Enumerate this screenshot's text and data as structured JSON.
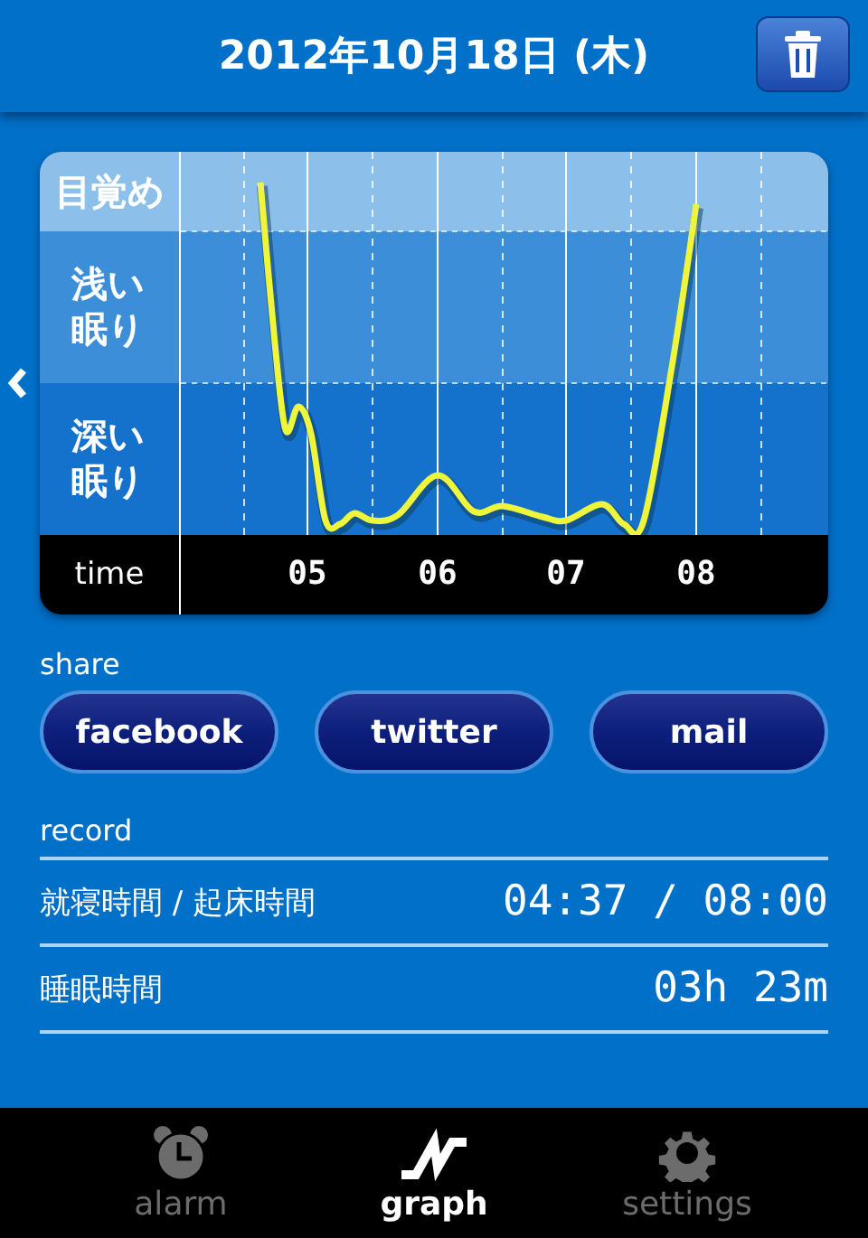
{
  "header": {
    "title": "2012年10月18日 (木)"
  },
  "chart": {
    "bands": [
      {
        "label": "目覚め",
        "kind": "awake"
      },
      {
        "label": "浅い眠り",
        "kind": "light"
      },
      {
        "label": "深い眠り",
        "kind": "deep"
      }
    ],
    "time_label": "time",
    "hours": [
      "05",
      "06",
      "07",
      "08"
    ]
  },
  "share": {
    "label": "share",
    "buttons": [
      "facebook",
      "twitter",
      "mail"
    ]
  },
  "record": {
    "label": "record",
    "rows": [
      {
        "name": "就寝時間 / 起床時間",
        "value": "04:37 / 08:00"
      },
      {
        "name": "睡眠時間",
        "value": "03h 23m"
      }
    ]
  },
  "tabs": [
    {
      "label": "alarm",
      "kind": "alarm",
      "selected": false
    },
    {
      "label": "graph",
      "kind": "graph",
      "selected": true
    },
    {
      "label": "settings",
      "kind": "settings",
      "selected": false
    }
  ]
}
